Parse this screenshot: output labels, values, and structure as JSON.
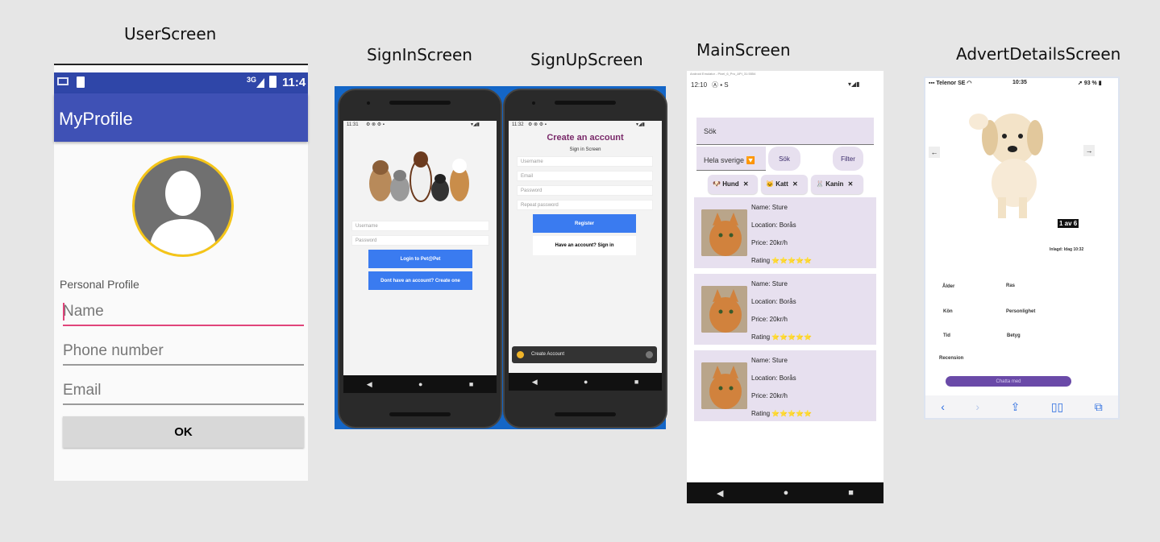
{
  "screens": {
    "user": "UserScreen",
    "signin": "SignInScreen",
    "signup": "SignUpScreen",
    "main": "MainScreen",
    "advert": "AdvertDetailsScreen"
  },
  "user_screen": {
    "status_net": "3G",
    "status_time": "11:4",
    "app_title": "MyProfile",
    "section_label": "Personal Profile",
    "name_placeholder": "Name",
    "phone_placeholder": "Phone number",
    "email_placeholder": "Email",
    "ok_label": "OK"
  },
  "signin_screen": {
    "status_time": "11:31",
    "username_placeholder": "Username",
    "password_placeholder": "Password",
    "login_label": "Login to Pet@Pet",
    "create_label": "Dont have an account? Create one",
    "nav_back": "◀",
    "nav_home": "●",
    "nav_recent": "■"
  },
  "signup_screen": {
    "status_time": "11:32",
    "title": "Create an account",
    "subtitle": "Sign in Screen",
    "username_placeholder": "Username",
    "email_placeholder": "Email",
    "password_placeholder": "Password",
    "repeat_placeholder": "Repeat password",
    "register_label": "Register",
    "have_account_label": "Have an account? Sign in",
    "toast": "Create Account",
    "nav_back": "◀",
    "nav_home": "●",
    "nav_recent": "■"
  },
  "main_screen": {
    "emulator_title": "Android Emulator - Pixel_6_Pro_API_31:5554",
    "status_time": "12:10",
    "search_placeholder": "Sök",
    "region": "Hela sverige 🔽",
    "search_button": "Sök",
    "filter_button": "Filter",
    "chips": [
      {
        "icon": "🐶",
        "label": "Hund"
      },
      {
        "icon": "🐱",
        "label": "Katt"
      },
      {
        "icon": "🐰",
        "label": "Kanin"
      }
    ],
    "chip_close": "✕",
    "listings": [
      {
        "name": "Name: Sture",
        "location": "Location: Borås",
        "price": "Price: 20kr/h",
        "rating": "Rating ⭐⭐⭐⭐⭐"
      },
      {
        "name": "Name: Sture",
        "location": "Location: Borås",
        "price": "Price: 20kr/h",
        "rating": "Rating ⭐⭐⭐⭐⭐"
      },
      {
        "name": "Name: Sture",
        "location": "Location: Borås",
        "price": "Price: 20kr/h",
        "rating": "Rating ⭐⭐⭐⭐⭐"
      }
    ],
    "nav_back": "◀",
    "nav_home": "●",
    "nav_recent": "■"
  },
  "advert_screen": {
    "carrier": "Telenor SE",
    "status_time": "10:35",
    "battery": "93 %",
    "prev_arrow": "←",
    "next_arrow": "→",
    "image_counter": "1 av 6",
    "posted": "Inlagd: Idag 10:32",
    "labels": [
      "Ålder",
      "Ras",
      "Kön",
      "Personlighet",
      "Tid",
      "Betyg",
      "Recension"
    ],
    "contact_button": "Chatta med"
  },
  "colors": {
    "page_bg": "#e6e6e6",
    "appbar": "#3f51b5",
    "primary_button": "#3a7bf0",
    "card_bg": "#e7e0ef",
    "accent_purple": "#7a2a6a"
  }
}
